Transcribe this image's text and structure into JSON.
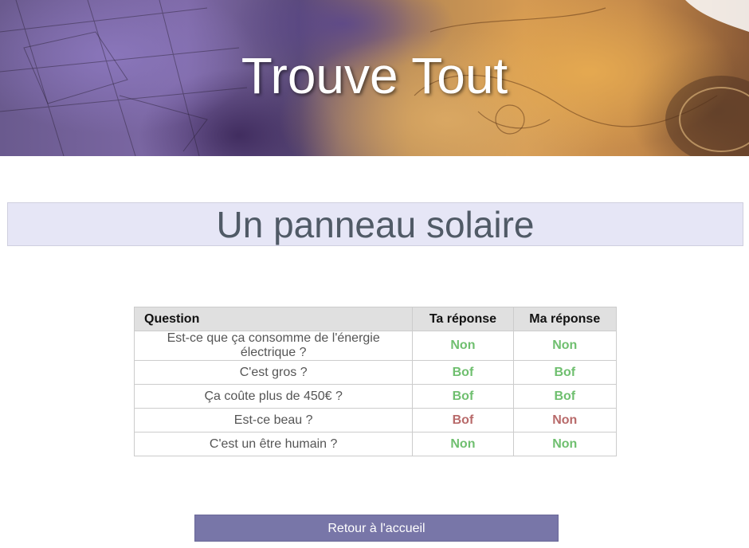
{
  "banner": {
    "title": "Trouve Tout"
  },
  "subject": {
    "title": "Un panneau solaire"
  },
  "table": {
    "headers": [
      "Question",
      "Ta réponse",
      "Ma réponse"
    ],
    "rows": [
      {
        "question": "Est-ce que ça consomme de l'énergie électrique ?",
        "yours": "Non",
        "yours_color": "#6fbf6f",
        "mine": "Non",
        "mine_color": "#6fbf6f"
      },
      {
        "question": "C'est gros ?",
        "yours": "Bof",
        "yours_color": "#6fbf6f",
        "mine": "Bof",
        "mine_color": "#6fbf6f"
      },
      {
        "question": "Ça coûte plus de 450€ ?",
        "yours": "Bof",
        "yours_color": "#6fbf6f",
        "mine": "Bof",
        "mine_color": "#6fbf6f"
      },
      {
        "question": "Est-ce beau ?",
        "yours": "Bof",
        "yours_color": "#b86a6a",
        "mine": "Non",
        "mine_color": "#b86a6a"
      },
      {
        "question": "C'est un être humain ?",
        "yours": "Non",
        "yours_color": "#6fbf6f",
        "mine": "Non",
        "mine_color": "#6fbf6f"
      }
    ]
  },
  "actions": {
    "home_label": "Retour à l'accueil"
  },
  "colors": {
    "match": "#6fbf6f",
    "mismatch": "#b86a6a",
    "button": "#7876a8",
    "subject_bg": "#e6e6f6"
  }
}
